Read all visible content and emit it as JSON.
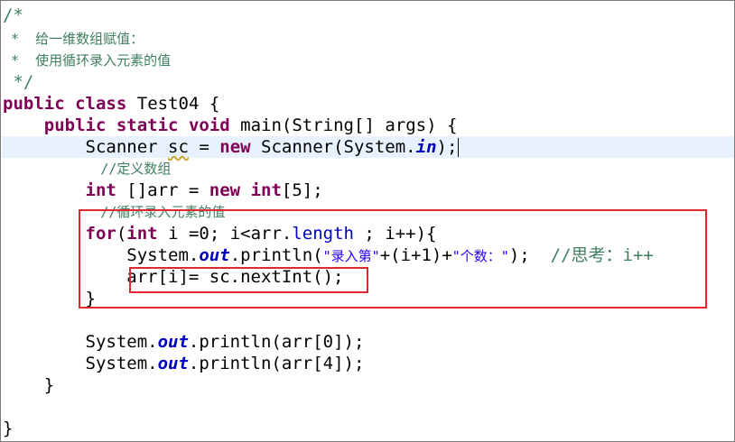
{
  "code": {
    "c1": "/*",
    "c2": " *  给一维数组赋值：",
    "c3": " *  使用循环录入元素的值",
    "c4": " */",
    "l5": {
      "kw1": "public",
      "kw2": "class",
      "name": "Test04 {"
    },
    "l6": {
      "kw1": "public",
      "kw2": "static",
      "kw3": "void",
      "rest": "main(String[] args) {"
    },
    "l7": {
      "a": "Scanner",
      "b": "sc",
      "c": " = ",
      "kw": "new",
      "d": " Scanner(System.",
      "e": "in",
      "f": ");"
    },
    "l8": "//定义数组",
    "l9": {
      "kw1": "int",
      "a": " []arr = ",
      "kw2": "new",
      "kw3": "int",
      "b": "[5];"
    },
    "l10": "//循环录入元素的值",
    "l11": {
      "kw1": "for",
      "a": "(",
      "kw2": "int",
      "b": " i =0; i<arr.",
      "c": "length",
      "d": " ; i++){"
    },
    "l12": {
      "a": "System.",
      "b": "out",
      "c": ".println(",
      "d": "\"录入第\"",
      "e": "+(i+1)+",
      "f": "\"个数：\"",
      "g": ");",
      "h": "//思考：i++"
    },
    "l13": "arr[i]= sc.nextInt();",
    "l14": "}",
    "l16": {
      "a": "System.",
      "b": "out",
      "c": ".println(arr[0]);"
    },
    "l17": {
      "a": "System.",
      "b": "out",
      "c": ".println(arr[4]);"
    },
    "l18": "}",
    "l20": "}"
  },
  "colors": {
    "keyword": "#7f0055",
    "comment": "#3f7f5f",
    "string": "#2a00ff",
    "field": "#0000c0",
    "current_line": "#e8f2fe",
    "annotation_box": "#e0282e"
  }
}
